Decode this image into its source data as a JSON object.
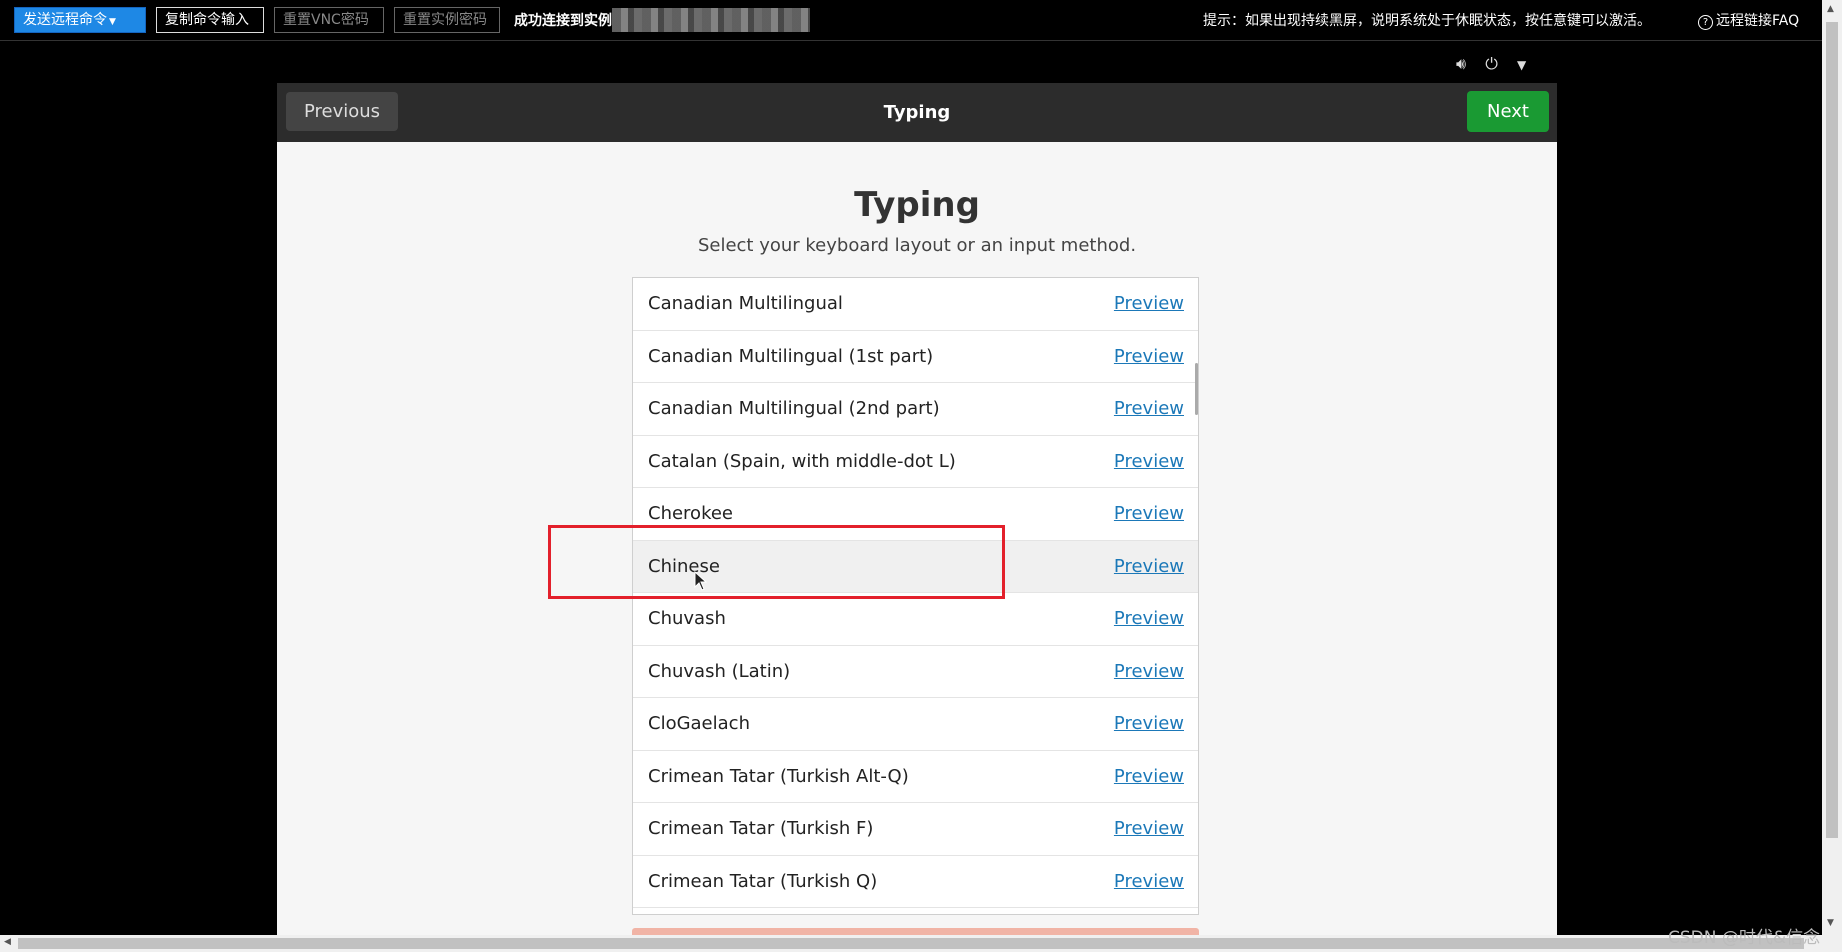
{
  "toolbar": {
    "send_command": "发送远程命令",
    "copy_input": "复制命令输入",
    "reset_vnc": "重置VNC密码",
    "reset_instance": "重置实例密码",
    "status": "成功连接到实例",
    "hint": "提示：如果出现持续黑屏，说明系统处于休眠状态，按任意键可以激活。",
    "faq": "远程链接FAQ"
  },
  "system_icons": [
    "speaker-icon",
    "power-icon",
    "dropdown-arrow-icon"
  ],
  "installer": {
    "header_title": "Typing",
    "previous_label": "Previous",
    "next_label": "Next",
    "title": "Typing",
    "subtitle": "Select your keyboard layout or an input method.",
    "preview_label": "Preview",
    "layouts": [
      "Canadian Multilingual",
      "Canadian Multilingual (1st part)",
      "Canadian Multilingual (2nd part)",
      "Catalan (Spain, with middle-dot L)",
      "Cherokee",
      "Chinese",
      "Chuvash",
      "Chuvash (Latin)",
      "CloGaelach",
      "Crimean Tatar (Turkish Alt-Q)",
      "Crimean Tatar (Turkish F)",
      "Crimean Tatar (Turkish Q)"
    ],
    "selected_layout": "Chinese"
  },
  "colors": {
    "next_button": "#1a9a33",
    "send_button": "#1e88e5",
    "annotation_box": "#e3202b",
    "preview_link": "#1b78b8"
  },
  "watermark": "CSDN @时代&信念"
}
